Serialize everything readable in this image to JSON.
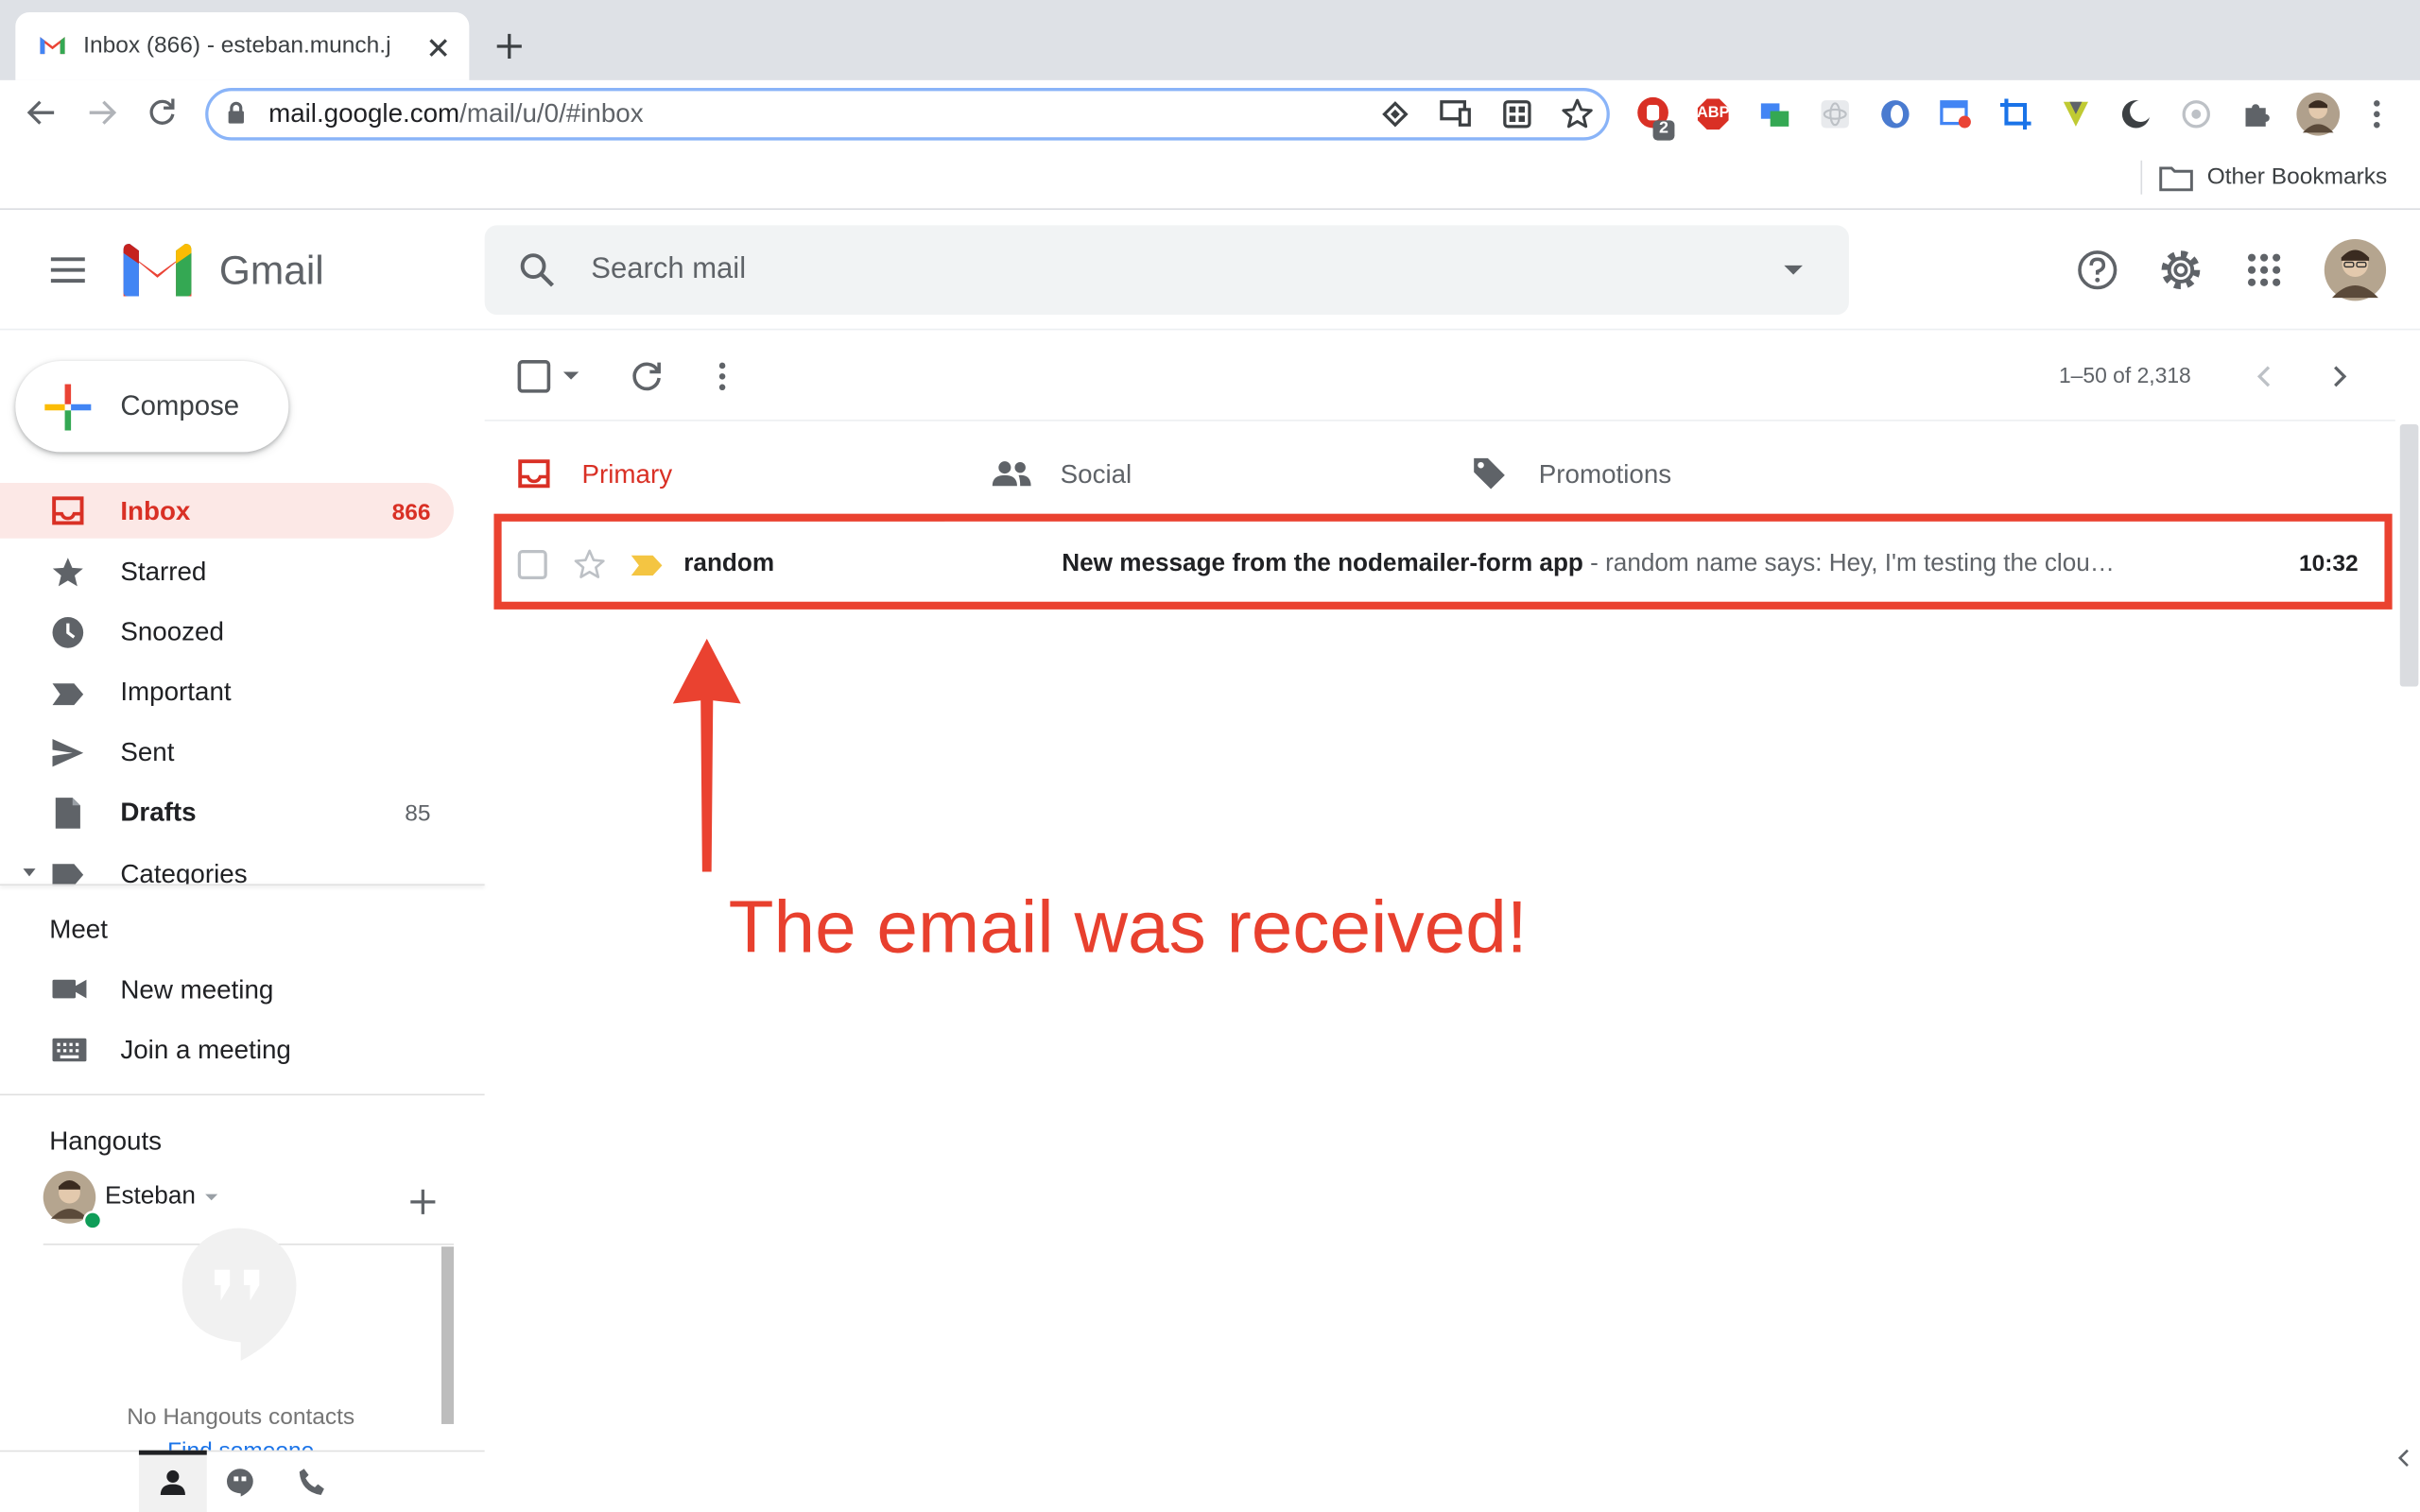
{
  "browser": {
    "tab_title": "Inbox (866) - esteban.munch.j",
    "url_host": "mail.google.com",
    "url_path": "/mail/u/0/#inbox",
    "ext_badge": "2",
    "abp_label": "ABP",
    "bookmarks_label": "Other Bookmarks"
  },
  "header": {
    "product_name": "Gmail",
    "search_placeholder": "Search mail"
  },
  "nav": {
    "compose_label": "Compose",
    "items": [
      {
        "label": "Inbox",
        "count": "866",
        "icon": "inbox-icon",
        "active": true
      },
      {
        "label": "Starred",
        "count": "",
        "icon": "star-icon"
      },
      {
        "label": "Snoozed",
        "count": "",
        "icon": "clock-icon"
      },
      {
        "label": "Important",
        "count": "",
        "icon": "important-icon"
      },
      {
        "label": "Sent",
        "count": "",
        "icon": "send-icon"
      },
      {
        "label": "Drafts",
        "count": "85",
        "icon": "draft-icon"
      },
      {
        "label": "Categories",
        "count": "",
        "icon": "label-icon"
      }
    ]
  },
  "meet": {
    "title": "Meet",
    "new_meeting": "New meeting",
    "join_meeting": "Join a meeting"
  },
  "hangouts": {
    "title": "Hangouts",
    "user_name": "Esteban",
    "empty_text": "No Hangouts contacts",
    "find_link": "Find someone"
  },
  "list": {
    "pager_text": "1–50 of 2,318",
    "categories": [
      {
        "label": "Primary",
        "icon": "inbox-icon",
        "active": true,
        "color": "#d93025"
      },
      {
        "label": "Social",
        "icon": "people-icon",
        "active": false,
        "color": "#5f6368"
      },
      {
        "label": "Promotions",
        "icon": "tag-icon",
        "active": false,
        "color": "#5f6368"
      }
    ],
    "row": {
      "sender": "random",
      "subject": "New message from the nodemailer-form app",
      "snippet": " - random name says: Hey, I'm testing the clou…",
      "time": "10:32"
    }
  },
  "annotation": {
    "text": "The email was received!",
    "color": "#ea4230"
  }
}
